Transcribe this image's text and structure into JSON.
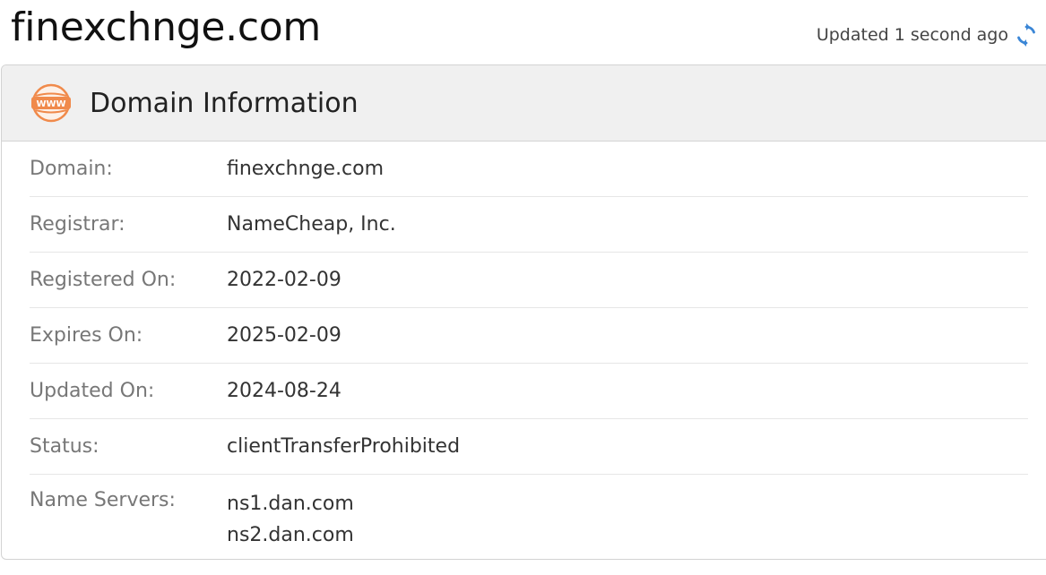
{
  "page": {
    "title": "finexchnge.com",
    "updated_text": "Updated 1 second ago"
  },
  "card": {
    "title": "Domain Information",
    "icon": "www-icon",
    "rows": [
      {
        "label": "Domain:",
        "value": "finexchnge.com"
      },
      {
        "label": "Registrar:",
        "value": "NameCheap, Inc."
      },
      {
        "label": "Registered On:",
        "value": "2022-02-09"
      },
      {
        "label": "Expires On:",
        "value": "2025-02-09"
      },
      {
        "label": "Updated On:",
        "value": "2024-08-24"
      },
      {
        "label": "Status:",
        "value": "clientTransferProhibited"
      },
      {
        "label": "Name Servers:",
        "values": [
          "ns1.dan.com",
          "ns2.dan.com"
        ]
      }
    ]
  },
  "colors": {
    "accent_orange": "#f08a4b",
    "refresh_blue": "#3b86d6",
    "header_bg": "#f0f0f0",
    "label_gray": "#777777"
  }
}
